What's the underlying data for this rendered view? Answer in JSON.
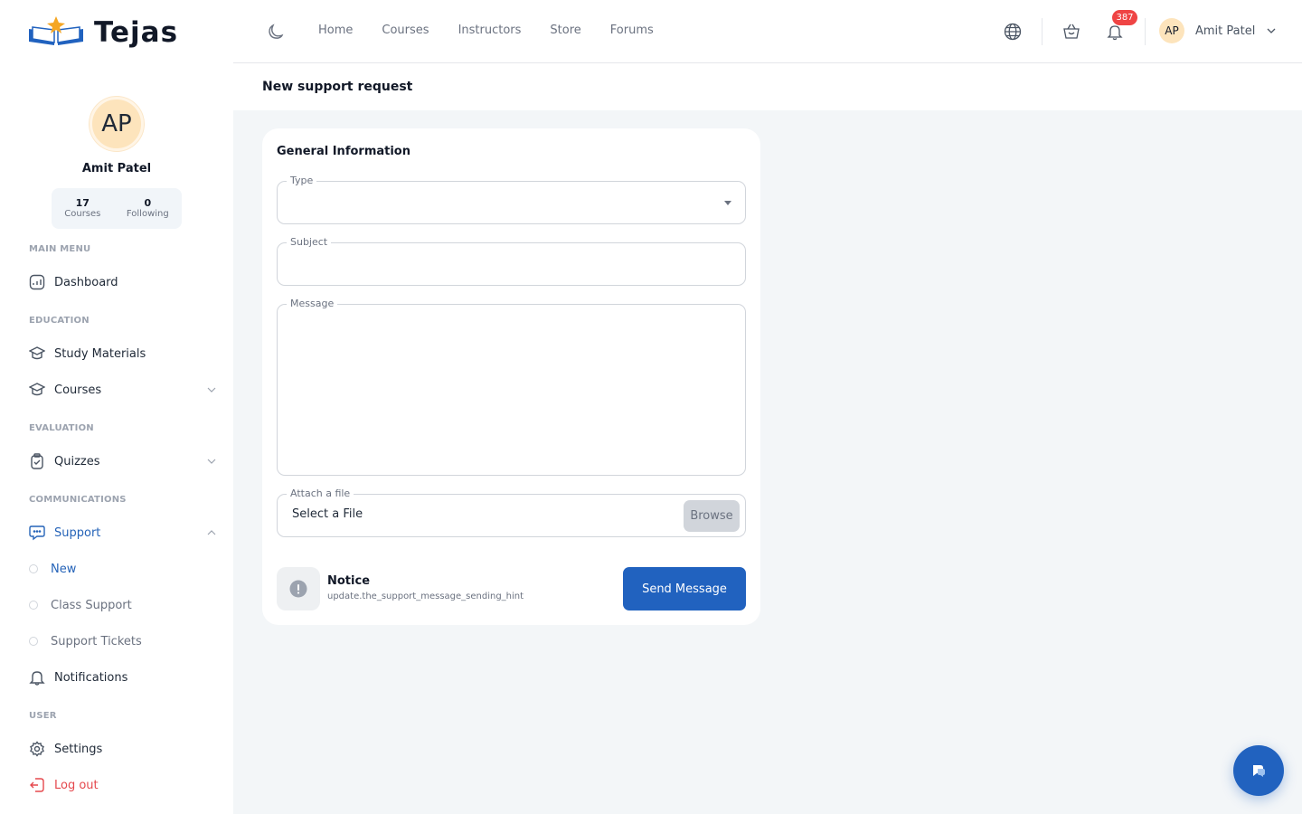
{
  "brand": {
    "name": "Tejas"
  },
  "colors": {
    "accent": "#2162bf",
    "active": "#2563b8",
    "danger": "#e5484d",
    "badge": "#ef4444",
    "avatar_bg": "#fde4bc"
  },
  "profile": {
    "initials": "AP",
    "name": "Amit Patel",
    "stats": [
      {
        "value": "17",
        "label": "Courses"
      },
      {
        "value": "0",
        "label": "Following"
      }
    ]
  },
  "sidebar": {
    "main_menu": {
      "title": "MAIN MENU",
      "items": [
        {
          "label": "Dashboard",
          "icon": "dashboard-icon"
        }
      ]
    },
    "education": {
      "title": "EDUCATION",
      "items": [
        {
          "label": "Study Materials",
          "icon": "graduation-cap-icon"
        },
        {
          "label": "Courses",
          "icon": "graduation-cap-icon"
        }
      ]
    },
    "evaluation": {
      "title": "EVALUATION",
      "items": [
        {
          "label": "Quizzes",
          "icon": "clipboard-check-icon"
        }
      ]
    },
    "communications": {
      "title": "COMMUNICATIONS",
      "support": {
        "label": "Support",
        "icon": "chat-icon"
      },
      "sub_items": [
        {
          "label": "New"
        },
        {
          "label": "Class Support"
        },
        {
          "label": "Support Tickets"
        }
      ],
      "notifications": {
        "label": "Notifications",
        "icon": "bell-icon"
      }
    },
    "user": {
      "title": "USER",
      "items": [
        {
          "label": "Settings",
          "icon": "gear-icon"
        },
        {
          "label": "Log out",
          "icon": "logout-icon"
        }
      ]
    }
  },
  "header": {
    "nav": [
      "Home",
      "Courses",
      "Instructors",
      "Store",
      "Forums"
    ],
    "notification_count": "387",
    "user": {
      "initials": "AP",
      "name": "Amit Patel"
    }
  },
  "page": {
    "title": "New support request"
  },
  "form": {
    "title": "General Information",
    "type_label": "Type",
    "subject_label": "Subject",
    "message_label": "Message",
    "attach_label": "Attach a file",
    "file_placeholder": "Select a File",
    "browse_label": "Browse",
    "notice_title": "Notice",
    "notice_hint": "update.the_support_message_sending_hint",
    "send_label": "Send Message"
  }
}
